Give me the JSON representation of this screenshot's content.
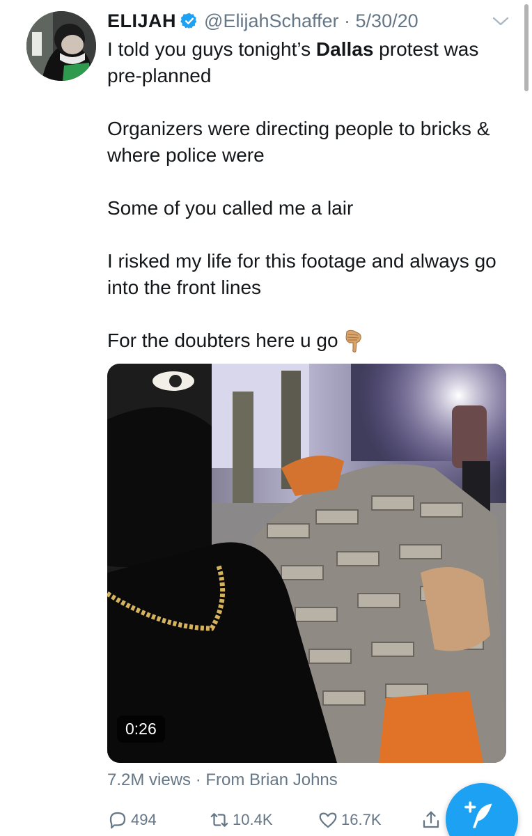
{
  "tweet": {
    "author_name": "ELIJAH",
    "handle_date": "@ElijahSchaffer · 5/30/20",
    "paragraphs": [
      {
        "before": "I told you guys tonight’s ",
        "bold": "Dallas",
        "after": " protest was pre-planned"
      },
      {
        "text": "Organizers were directing people to bricks & where police were"
      },
      {
        "text": "Some of you called me a lair"
      },
      {
        "text": "I risked my life for this footage and always go into the front lines"
      },
      {
        "text": "For the doubters here u go"
      }
    ]
  },
  "media": {
    "duration": "0:26",
    "views": "7.2M views",
    "from": "From Brian Johns"
  },
  "actions": {
    "replies": "494",
    "retweets": "10.4K",
    "likes": "16.7K"
  },
  "icons": {
    "verified": "verified-badge-icon",
    "chevron": "chevron-down-icon",
    "emoji": "backhand-index-pointing-down-emoji",
    "reply": "reply-icon",
    "retweet": "retweet-icon",
    "like": "heart-icon",
    "share": "share-icon",
    "compose": "compose-tweet-icon"
  },
  "colors": {
    "accent": "#1da1f2",
    "secondary_text": "#657786",
    "primary_text": "#14171a"
  }
}
